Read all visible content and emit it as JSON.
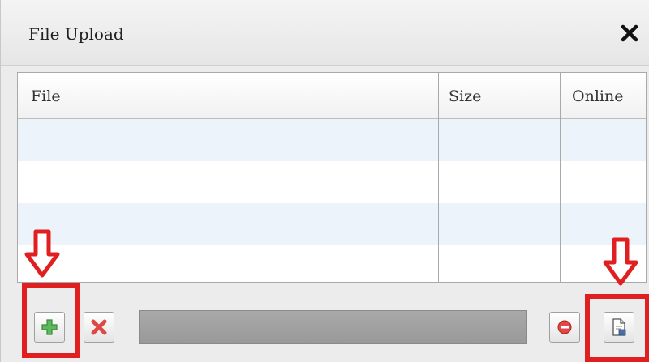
{
  "dialog": {
    "title": "File Upload",
    "close_icon": "close-icon"
  },
  "grid": {
    "columns": [
      "File",
      "Size",
      "Online"
    ],
    "rows": []
  },
  "toolbar": {
    "add_icon": "add-icon",
    "remove_icon": "remove-icon",
    "cancel_icon": "cancel-icon",
    "upload_icon": "upload-file-icon",
    "progress": 0
  },
  "annotations": {
    "highlight_color": "#e02020",
    "arrow_icon": "down-arrow-icon"
  }
}
